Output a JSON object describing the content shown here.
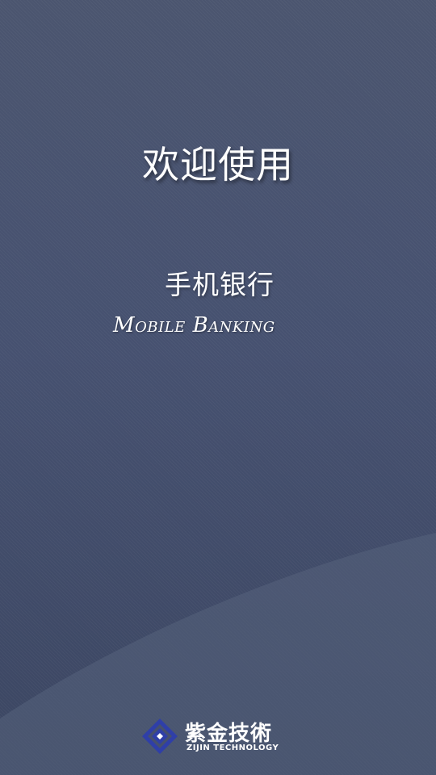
{
  "welcome": {
    "title": "欢迎使用"
  },
  "app": {
    "name_cn": "手机银行",
    "name_en": "Mobile Banking"
  },
  "brand": {
    "name_cn": "紫金技術",
    "name_en": "ZIJIN TECHNOLOGY",
    "logo_icon": "zijin-diamond-logo-icon",
    "logo_color": "#2f3fa8"
  },
  "colors": {
    "background_top": "#4b556f",
    "background_bottom": "#3b4662",
    "wave_highlight": "#4f5b78",
    "text": "#ffffff"
  }
}
